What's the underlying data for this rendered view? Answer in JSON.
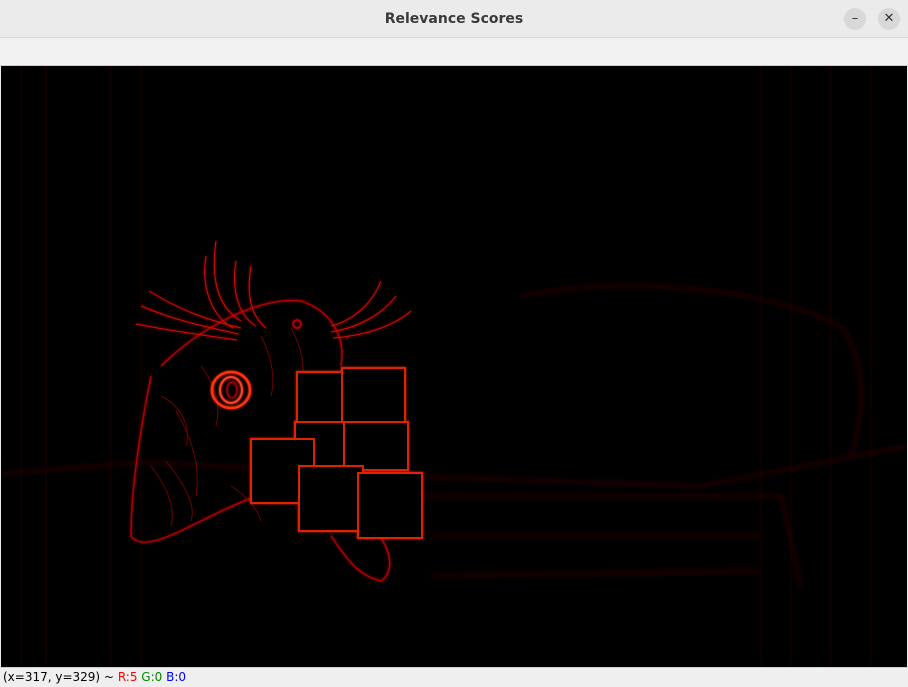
{
  "window": {
    "title": "Relevance Scores",
    "minimize_glyph": "–",
    "close_glyph": "✕"
  },
  "image": {
    "description_icon": "relevance-heatmap",
    "accent_color": "#ff2000"
  },
  "status": {
    "coords": "(x=317, y=329) ~",
    "r": "R:5",
    "g": "G:0",
    "b": "B:0"
  }
}
